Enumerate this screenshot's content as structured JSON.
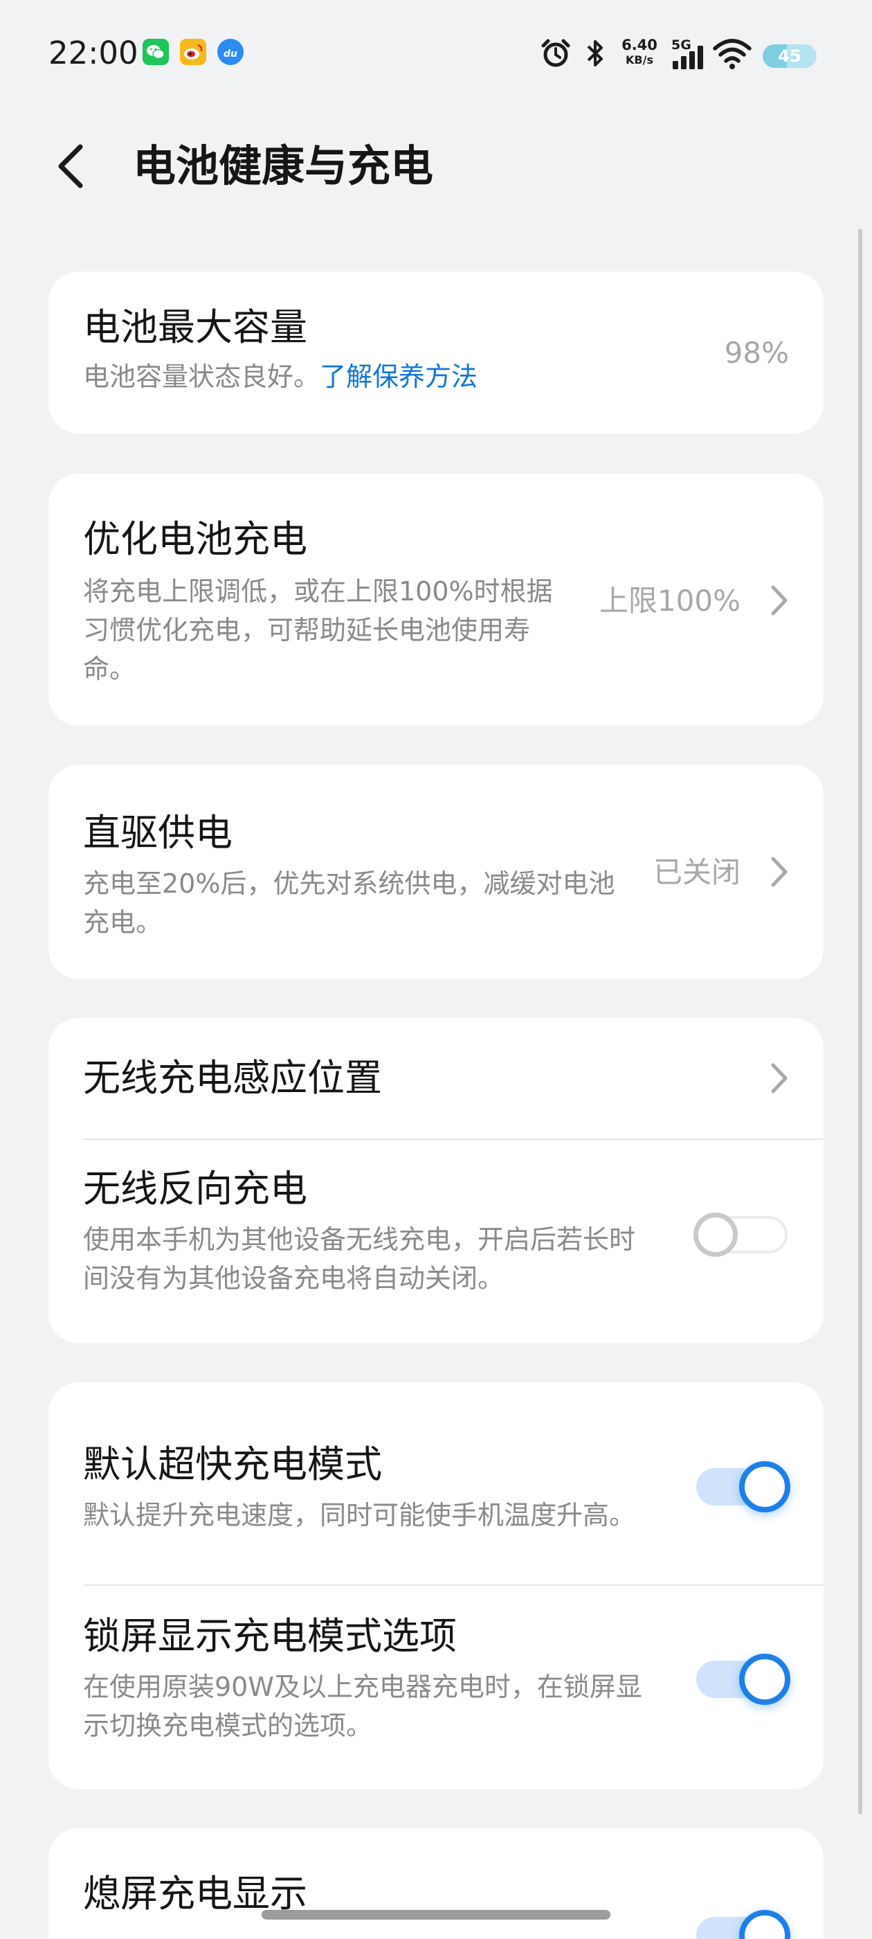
{
  "status_bar": {
    "time": "22:00",
    "apps": [
      {
        "icon": "wechat-icon",
        "color": "#1fc45a"
      },
      {
        "icon": "weibo-icon",
        "color": "#f6b91d"
      },
      {
        "icon": "baidu-du-icon",
        "color": "#2b8cf0"
      }
    ],
    "net_speed_value": "6.40",
    "net_speed_unit": "KB/s",
    "network": "5G",
    "battery": "45",
    "battery_level": 0.45
  },
  "header": {
    "title": "电池健康与充电"
  },
  "cards": {
    "capacity": {
      "title": "电池最大容量",
      "subtitle": "电池容量状态良好。",
      "link": "了解保养方法",
      "value": "98%"
    },
    "optimize": {
      "title": "优化电池充电",
      "subtitle_lines": [
        "将充电上限调低，或在上限100%时根据",
        "习惯优化充电，可帮助延长电池使用寿",
        "命。"
      ],
      "value": "上限100%"
    },
    "bypass": {
      "title": "直驱供电",
      "subtitle_lines": [
        "充电至20%后，优先对系统供电，减缓对电池",
        "充电。"
      ],
      "value": "已关闭"
    },
    "wireless": {
      "position_title": "无线充电感应位置",
      "reverse_title": "无线反向充电",
      "reverse_subtitle_lines": [
        "使用本手机为其他设备无线充电，开启后若长时",
        "间没有为其他设备充电将自动关闭。"
      ],
      "reverse_enabled": false
    },
    "fast": {
      "default_title": "默认超快充电模式",
      "default_subtitle": "默认提升充电速度，同时可能使手机温度升高。",
      "default_enabled": true,
      "lockscreen_title": "锁屏显示充电模式选项",
      "lockscreen_subtitle_lines": [
        "在使用原装90W及以上充电器充电时，在锁屏显",
        "示切换充电模式的选项。"
      ],
      "lockscreen_enabled": true
    },
    "screen_off": {
      "title": "熄屏充电显示"
    }
  },
  "colors": {
    "accent": "#1f7fe8",
    "link": "#1475d6",
    "background": "#f1f2f4"
  }
}
